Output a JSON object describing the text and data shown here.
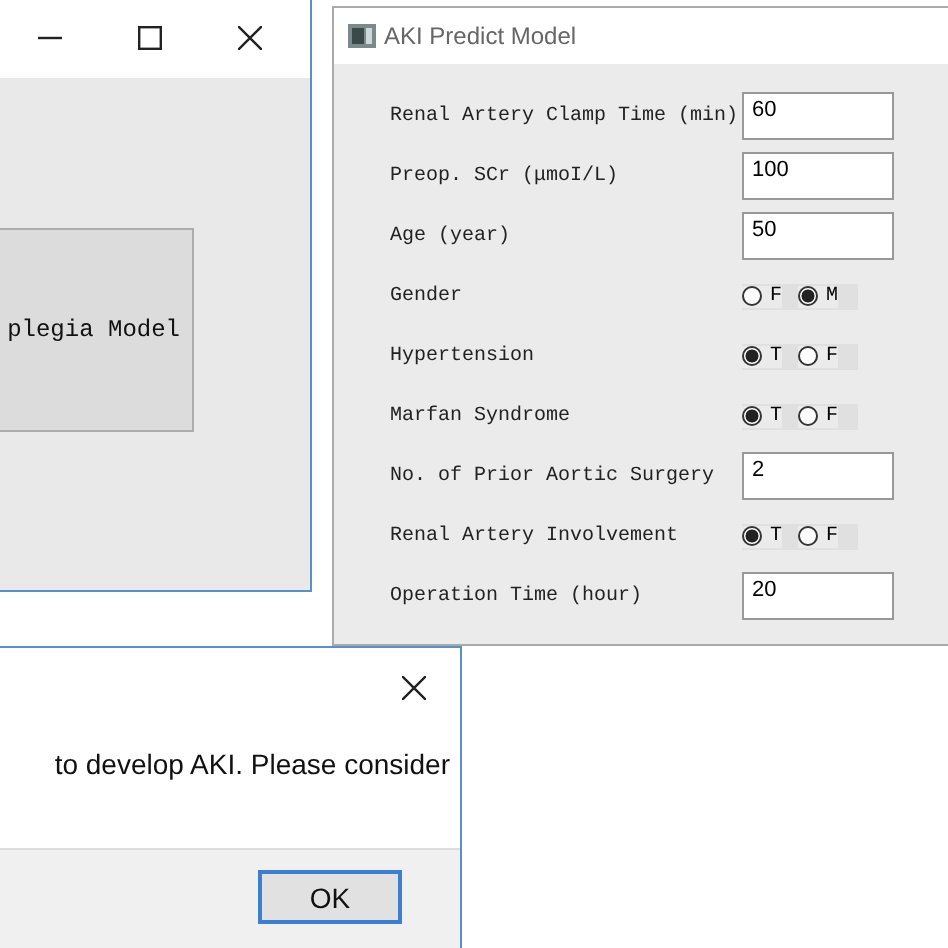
{
  "back_window": {
    "button_label": "plegia Model"
  },
  "predict_window": {
    "title": "AKI Predict Model",
    "fields": [
      {
        "kind": "text",
        "label": "Renal Artery Clamp Time (min)",
        "value": "60"
      },
      {
        "kind": "text",
        "label": "Preop. SCr (μmoI/L)",
        "value": "100"
      },
      {
        "kind": "text",
        "label": "Age (year)",
        "value": "50"
      },
      {
        "kind": "radio",
        "label": "Gender",
        "options": [
          {
            "label": "F",
            "selected": false
          },
          {
            "label": "M",
            "selected": true
          }
        ]
      },
      {
        "kind": "radio",
        "label": "Hypertension",
        "options": [
          {
            "label": "T",
            "selected": true
          },
          {
            "label": "F",
            "selected": false
          }
        ]
      },
      {
        "kind": "radio",
        "label": "Marfan Syndrome",
        "options": [
          {
            "label": "T",
            "selected": true
          },
          {
            "label": "F",
            "selected": false
          }
        ]
      },
      {
        "kind": "text",
        "label": "No. of Prior Aortic Surgery",
        "value": "2"
      },
      {
        "kind": "radio",
        "label": "Renal Artery Involvement",
        "options": [
          {
            "label": "T",
            "selected": true
          },
          {
            "label": "F",
            "selected": false
          }
        ]
      },
      {
        "kind": "text",
        "label": "Operation Time (hour)",
        "value": "20"
      }
    ]
  },
  "message_dialog": {
    "message": "to develop AKI. Please consider",
    "button": "OK"
  }
}
